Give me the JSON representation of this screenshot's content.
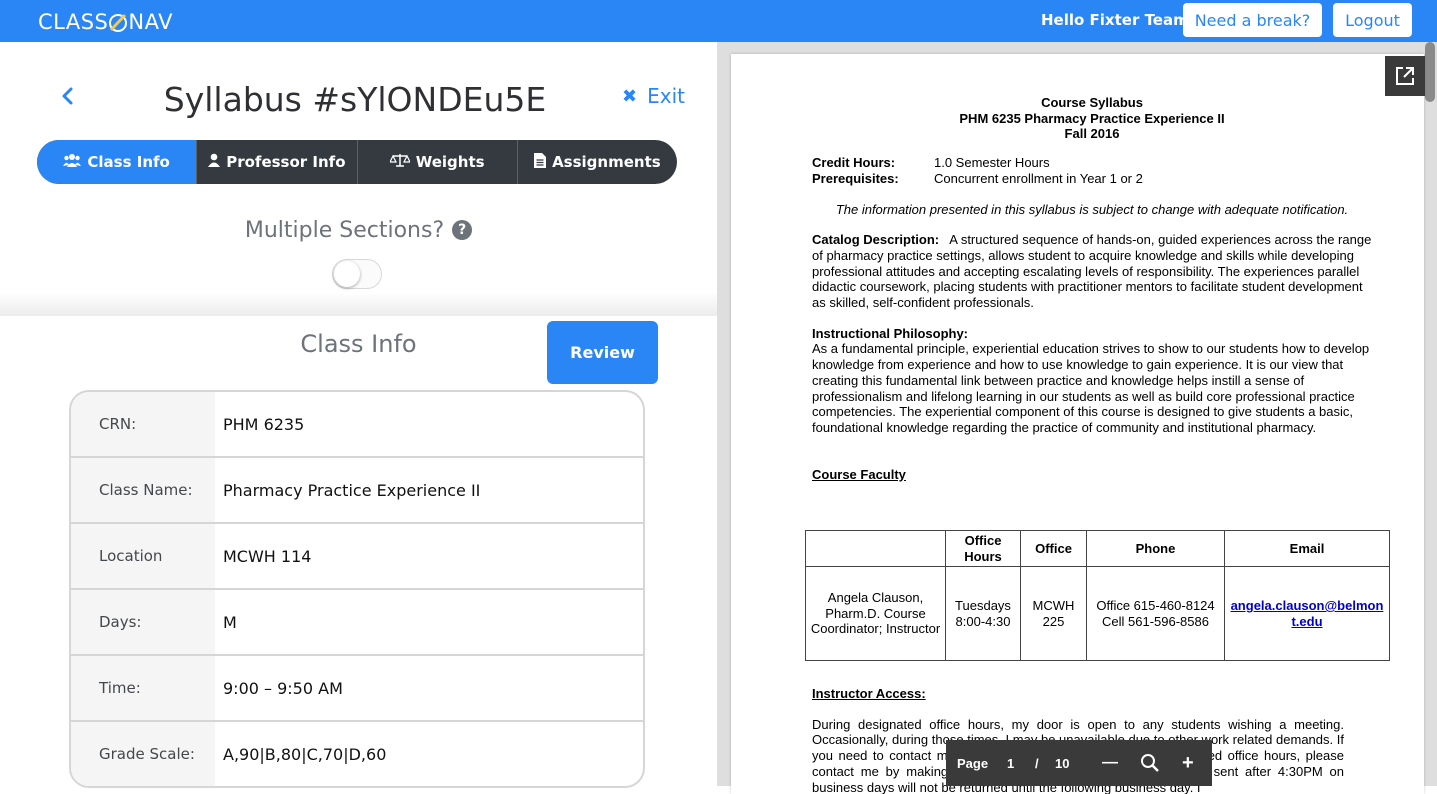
{
  "app": {
    "logo_left": "CLASS",
    "logo_right": "NAV"
  },
  "header": {
    "greeting": "Hello Fixter Team",
    "break_label": "Need a break?",
    "logout_label": "Logout"
  },
  "syllabus": {
    "title": "Syllabus #sYlONDEu5E",
    "exit_label": "Exit"
  },
  "tabs": [
    {
      "label": "Class Info",
      "icon": "users-icon",
      "active": true
    },
    {
      "label": "Professor Info",
      "icon": "user-icon",
      "active": false
    },
    {
      "label": "Weights",
      "icon": "scale-icon",
      "active": false
    },
    {
      "label": "Assignments",
      "icon": "document-icon",
      "active": false
    }
  ],
  "multiple_sections": {
    "label": "Multiple Sections?",
    "enabled": false
  },
  "class_info": {
    "heading": "Class Info",
    "review_label": "Review",
    "rows": [
      {
        "label": "CRN:",
        "value": "PHM 6235"
      },
      {
        "label": "Class Name:",
        "value": "Pharmacy Practice Experience II"
      },
      {
        "label": "Location",
        "value": "MCWH 114"
      },
      {
        "label": "Days:",
        "value": "M"
      },
      {
        "label": "Time:",
        "value": "9:00 – 9:50 AM"
      },
      {
        "label": "Grade Scale:",
        "value": "A,90|B,80|C,70|D,60"
      }
    ]
  },
  "pdf": {
    "header_line1": "Course Syllabus",
    "header_line2": "PHM 6235 Pharmacy Practice Experience II",
    "header_line3": "Fall 2016",
    "credit_label": "Credit Hours:",
    "credit_value": "1.0 Semester Hours",
    "prereq_label": "Prerequisites:",
    "prereq_value": "Concurrent enrollment in Year 1 or 2",
    "notice": "The information presented in this syllabus is subject to change with adequate notification.",
    "catalog_label": "Catalog Description:",
    "catalog_text": "A structured sequence of hands-on, guided experiences across the range of pharmacy practice settings, allows student to acquire knowledge and skills while developing professional attitudes and accepting escalating levels of responsibility. The experiences parallel didactic coursework, placing students with practitioner mentors to facilitate student development as skilled, self-confident professionals.",
    "philosophy_label": "Instructional Philosophy:",
    "philosophy_text": "As a fundamental principle, experiential education strives to show to our students how to develop knowledge from experience and how to use knowledge to gain experience. It is our view that creating this fundamental link between practice and knowledge helps instill a sense of professionalism and lifelong learning in our students as well as build core professional practice competencies.  The experiential component of this course is designed to give students a basic, foundational knowledge regarding the practice of community and institutional pharmacy.",
    "faculty_label": "Course Faculty",
    "faculty_headers": [
      "",
      "Office Hours",
      "Office",
      "Phone",
      "Email"
    ],
    "faculty_row": {
      "name": "Angela Clauson, Pharm.D. Course Coordinator; Instructor",
      "hours": "Tuesdays 8:00-4:30",
      "office": "MCWH 225",
      "phone": "Office 615-460-8124 Cell 561-596-8586",
      "email": "angela.clauson@belmont.edu"
    },
    "access_label": "Instructor Access:",
    "access_text": "During designated office hours, my door is open to any students wishing a meeting. Occasionally, during those times, I may be unavailable due to other work related demands.  If you need to contact me and I am not in my office during my posted office hours, please contact me by making an appointment through email.  Any email sent after 4:30PM on business days will not be returned until the following business day. I",
    "toolbar": {
      "page_label": "Page",
      "current_page": "1",
      "separator": "/",
      "total_pages": "10",
      "zoom_out": "—",
      "zoom_in": "+"
    }
  }
}
